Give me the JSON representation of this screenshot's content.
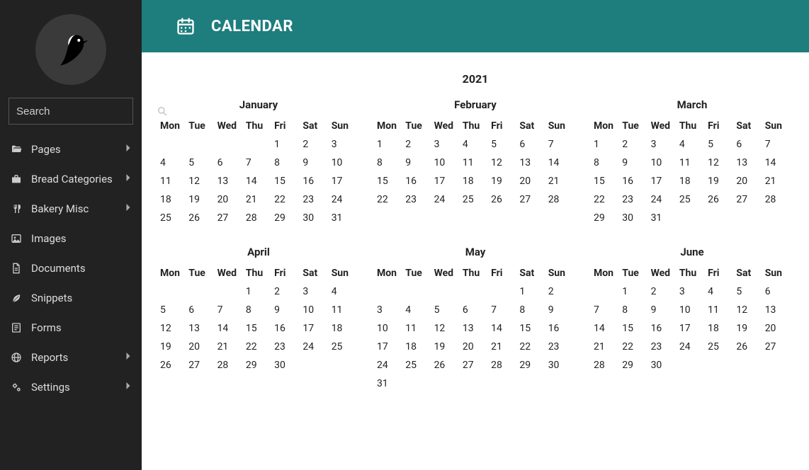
{
  "sidebar": {
    "search_placeholder": "Search",
    "items": [
      {
        "icon": "folder-open",
        "label": "Pages",
        "chev": true
      },
      {
        "icon": "briefcase",
        "label": "Bread Categories",
        "chev": true
      },
      {
        "icon": "utensils",
        "label": "Bakery Misc",
        "chev": true
      },
      {
        "icon": "image",
        "label": "Images",
        "chev": false
      },
      {
        "icon": "file",
        "label": "Documents",
        "chev": false
      },
      {
        "icon": "leaf",
        "label": "Snippets",
        "chev": false
      },
      {
        "icon": "form",
        "label": "Forms",
        "chev": false
      },
      {
        "icon": "globe",
        "label": "Reports",
        "chev": true
      },
      {
        "icon": "cogs",
        "label": "Settings",
        "chev": true
      }
    ]
  },
  "header": {
    "title": "CALENDAR"
  },
  "calendar": {
    "year": "2021",
    "weekdays": [
      "Mon",
      "Tue",
      "Wed",
      "Thu",
      "Fri",
      "Sat",
      "Sun"
    ],
    "months": [
      {
        "name": "January",
        "offset": 4,
        "days": 31
      },
      {
        "name": "February",
        "offset": 0,
        "days": 28
      },
      {
        "name": "March",
        "offset": 0,
        "days": 31
      },
      {
        "name": "April",
        "offset": 3,
        "days": 30
      },
      {
        "name": "May",
        "offset": 5,
        "days": 31
      },
      {
        "name": "June",
        "offset": 1,
        "days": 30
      }
    ]
  }
}
